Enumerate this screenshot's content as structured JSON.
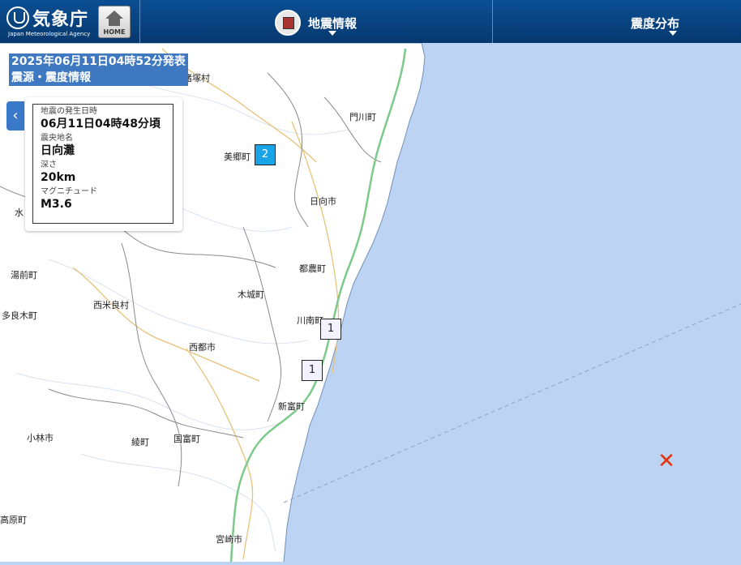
{
  "header": {
    "logo_text": "気象庁",
    "logo_subtitle": "Japan Meteorological Agency",
    "home_label": "HOME",
    "menu_earthquake": "地震情報",
    "menu_intensity": "震度分布"
  },
  "issued": {
    "line1": "2025年06月11日04時52分発表",
    "line2": "震源・震度情報"
  },
  "info": {
    "time_label": "地震の発生日時",
    "time_value": "06月11日04時48分頃",
    "place_label": "震央地名",
    "place_value": "日向灘",
    "depth_label": "深さ",
    "depth_value": "20km",
    "magnitude_label": "マグニチュード",
    "magnitude_value": "M3.6"
  },
  "places": [
    "諸塚村",
    "門川町",
    "美郷町",
    "日向市",
    "都農町",
    "木城町",
    "川南町",
    "西米良村",
    "西都市",
    "新富町",
    "湯前町",
    "多良木町",
    "小林市",
    "綾町",
    "国富町",
    "宮崎市",
    "高原町",
    "水"
  ],
  "intensity_markers": [
    {
      "value": "2",
      "near": "美郷町"
    },
    {
      "value": "1",
      "near": "川南町"
    },
    {
      "value": "1",
      "near": "新富町"
    }
  ],
  "epicenter_icon": "epicenter-x-icon",
  "colors": {
    "sea": "#bcd3f3",
    "land": "#ffffff",
    "header": "#0b4f93",
    "epicenter": "#e8300a",
    "intensity_2": "#1aa4e8"
  }
}
